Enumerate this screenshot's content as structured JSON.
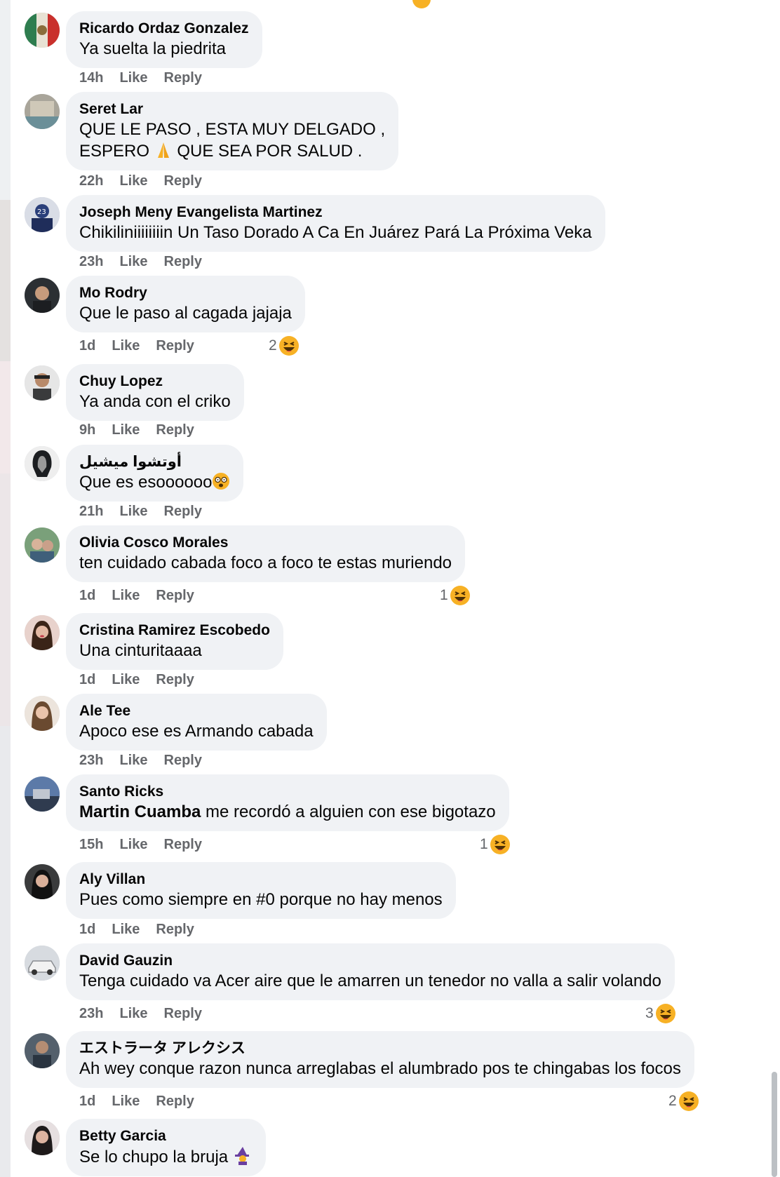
{
  "ui": {
    "like_label": "Like",
    "reply_label": "Reply",
    "accent_color": "#65676b",
    "bubble_color": "#f0f2f5",
    "reaction_icon": "haha-emoji-icon"
  },
  "comments": [
    {
      "author": "Ricardo Ordaz Gonzalez",
      "text": "Ya suelta la piedrita",
      "time": "14h"
    },
    {
      "author": "Seret Lar",
      "text_line1": "QUE LE PASO , ESTA MUY DELGADO ,",
      "text_line2_before": "ESPERO",
      "text_line2_emoji": "folded-hands-emoji",
      "text_line2_after": "QUE SEA POR SALUD .",
      "time": "22h"
    },
    {
      "author": "Joseph Meny Evangelista Martinez",
      "text": "Chikiliniiiiiiiin Un Taso Dorado A Ca En Juárez Pará La Próxima Veka",
      "time": "23h"
    },
    {
      "author": "Mo Rodry",
      "text": "Que le paso al cagada jajaja",
      "time": "1d",
      "reaction_count": "2"
    },
    {
      "author": "Chuy Lopez",
      "text": "Ya anda con el criko",
      "time": "9h"
    },
    {
      "author": "أوتشوا ميشيل",
      "text": "Que es esoooooo",
      "text_emoji": "dizzy-face-emoji",
      "time": "21h"
    },
    {
      "author": "Olivia Cosco Morales",
      "text": "ten cuidado cabada foco a foco te estas muriendo",
      "time": "1d",
      "reaction_count": "1"
    },
    {
      "author": "Cristina Ramirez Escobedo",
      "text": "Una cinturitaaaa",
      "time": "1d"
    },
    {
      "author": "Ale Tee",
      "text": "Apoco ese es Armando cabada",
      "time": "23h"
    },
    {
      "author": "Santo Ricks",
      "mention": "Martin Cuamba",
      "text": "me recordó a alguien con ese bigotazo",
      "time": "15h",
      "reaction_count": "1"
    },
    {
      "author": "Aly Villan",
      "text": "Pues como siempre en #0 porque no hay menos",
      "time": "1d"
    },
    {
      "author": "David Gauzin",
      "text": "Tenga cuidado va Acer aire que le amarren un tenedor no valla a salir volando",
      "time": "23h",
      "reaction_count": "3"
    },
    {
      "author": "エストラータ アレクシス",
      "text": "Ah wey conque razon nunca arreglabas el alumbrado pos te chingabas los focos",
      "time": "1d",
      "reaction_count": "2"
    },
    {
      "author": "Betty Garcia",
      "text": "Se lo chupo la bruja",
      "text_emoji": "witch-emoji",
      "time": ""
    }
  ]
}
